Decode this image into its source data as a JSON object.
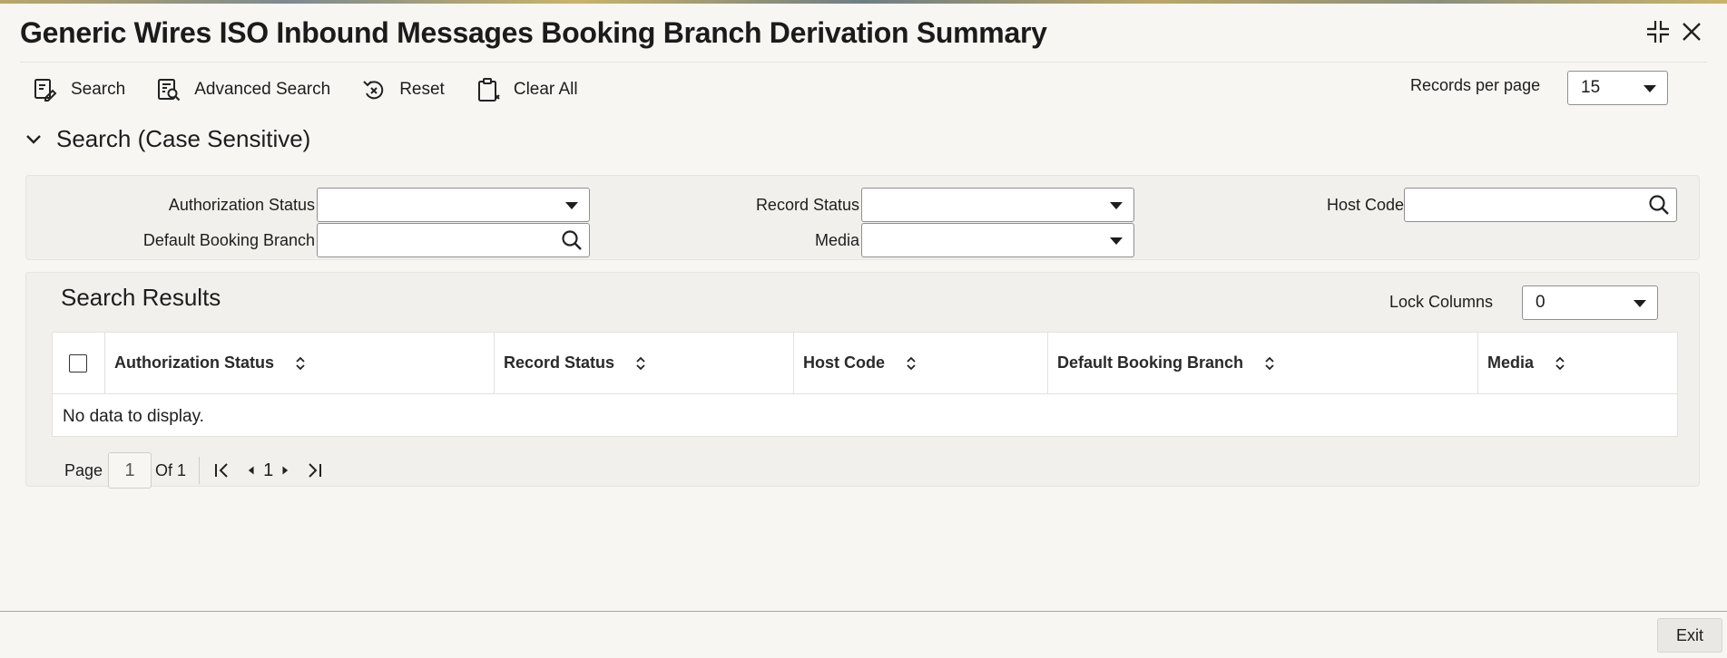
{
  "window": {
    "title": "Generic Wires ISO Inbound Messages Booking Branch Derivation Summary"
  },
  "toolbar": {
    "search_label": "Search",
    "advanced_search_label": "Advanced Search",
    "reset_label": "Reset",
    "clear_all_label": "Clear All"
  },
  "records_per_page": {
    "label": "Records per page",
    "value": "15"
  },
  "search_section": {
    "title": "Search (Case Sensitive)",
    "fields": {
      "authorization_status": {
        "label": "Authorization Status",
        "value": ""
      },
      "record_status": {
        "label": "Record Status",
        "value": ""
      },
      "host_code": {
        "label": "Host Code",
        "value": ""
      },
      "default_booking_branch": {
        "label": "Default Booking Branch",
        "value": ""
      },
      "media": {
        "label": "Media",
        "value": ""
      }
    }
  },
  "results": {
    "title": "Search Results",
    "lock_columns": {
      "label": "Lock Columns",
      "value": "0"
    },
    "columns": [
      "Authorization Status",
      "Record Status",
      "Host Code",
      "Default Booking Branch",
      "Media"
    ],
    "empty_message": "No data to display."
  },
  "pagination": {
    "page_label": "Page",
    "current_page": "1",
    "of_label": "Of 1",
    "page_number": "1"
  },
  "footer": {
    "exit_label": "Exit"
  },
  "icons": [
    "search-icon",
    "advanced-search-icon",
    "reset-icon",
    "clear-all-icon",
    "maximize-icon",
    "close-icon",
    "chevron-down-icon",
    "magnifier-icon",
    "sort-icon",
    "first-page-icon",
    "previous-page-icon",
    "next-page-icon",
    "last-page-icon"
  ]
}
